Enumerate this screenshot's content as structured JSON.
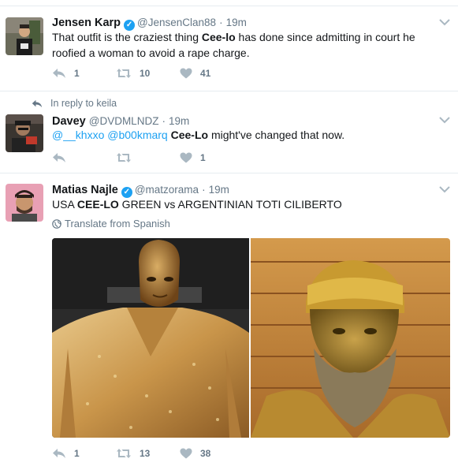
{
  "tweets": [
    {
      "fullname": "Jensen Karp",
      "handle": "@JensenClan88",
      "time": "19m",
      "text_parts": {
        "a": "That outfit is the craziest thing ",
        "b": "Cee-lo",
        "c": " has done since admitting in court he roofied a woman to avoid a rape charge."
      },
      "counts": {
        "reply": "1",
        "retweet": "10",
        "like": "41"
      }
    },
    {
      "reply_context": "In reply to keila",
      "fullname": "Davey",
      "handle": "@DVDMLNDZ",
      "time": "19m",
      "text_parts": {
        "mention1": "@__khxxo",
        "mention2": "@b00kmarq",
        "b": "Cee-Lo",
        "c": " might've changed that now."
      },
      "counts": {
        "reply": "",
        "retweet": "",
        "like": "1"
      }
    },
    {
      "fullname": "Matias Najle",
      "handle": "@matzorama",
      "time": "19m",
      "text_parts": {
        "a": "USA ",
        "b": "CEE-LO",
        "c": " GREEN vs ARGENTINIAN TOTI CILIBERTO"
      },
      "translate": "Translate from Spanish",
      "counts": {
        "reply": "1",
        "retweet": "13",
        "like": "38"
      }
    }
  ],
  "dot": "·",
  "icons": {
    "verified": "verified-badge-icon",
    "caret": "chevron-down-icon",
    "reply": "reply-icon",
    "retweet": "retweet-icon",
    "like": "heart-icon",
    "globe": "globe-icon"
  },
  "colors": {
    "accent": "#1da1f2",
    "muted": "#657786",
    "icon": "#aab8c2",
    "text": "#14171a",
    "border": "#e6ecf0"
  }
}
